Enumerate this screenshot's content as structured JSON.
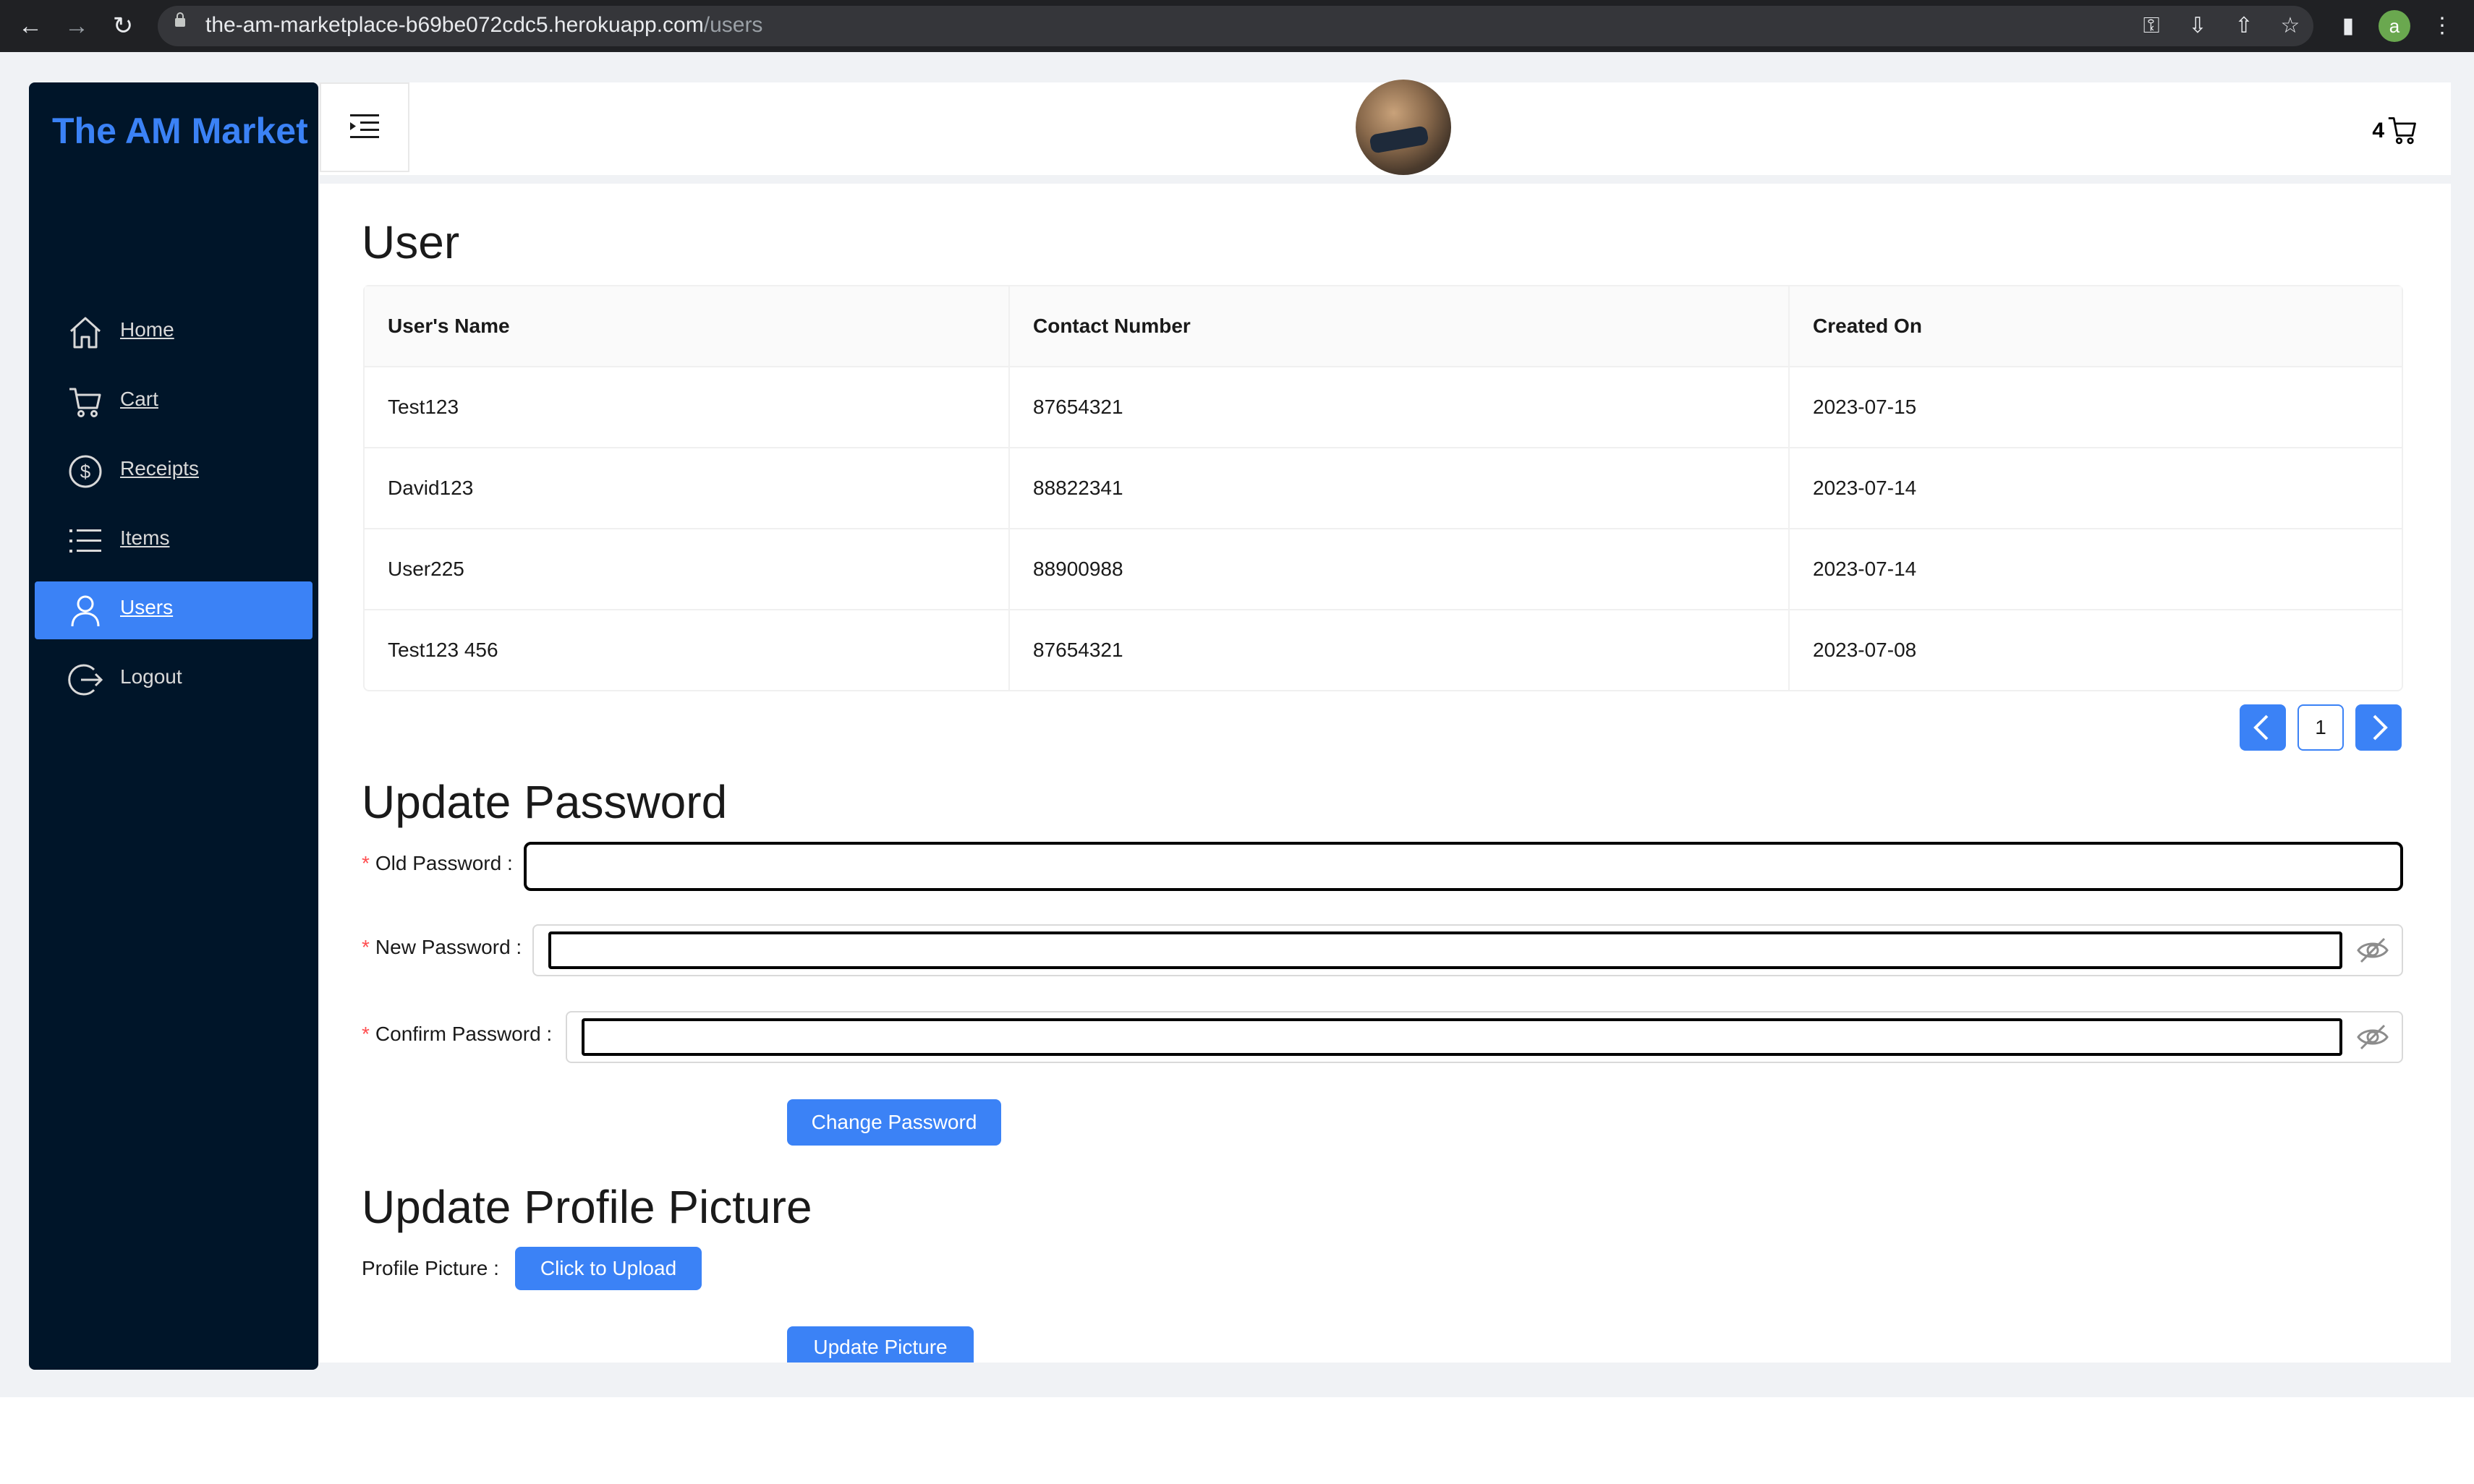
{
  "browser": {
    "url_host": "the-am-marketplace-b69be072cdc5.herokuapp.com",
    "url_path": "/users",
    "profile_initial": "a"
  },
  "sidebar": {
    "logo": "The AM Market",
    "items": [
      {
        "label": "Home",
        "icon": "home-icon"
      },
      {
        "label": "Cart",
        "icon": "cart-icon"
      },
      {
        "label": "Receipts",
        "icon": "dollar-icon"
      },
      {
        "label": "Items",
        "icon": "list-icon"
      },
      {
        "label": "Users",
        "icon": "user-icon",
        "active": true
      },
      {
        "label": "Logout",
        "icon": "logout-icon"
      }
    ]
  },
  "header": {
    "cart_count": "4"
  },
  "users": {
    "title": "User",
    "columns": [
      "User's Name",
      "Contact Number",
      "Created On"
    ],
    "rows": [
      [
        "Test123",
        "87654321",
        "2023-07-15"
      ],
      [
        "David123",
        "88822341",
        "2023-07-14"
      ],
      [
        "User225",
        "88900988",
        "2023-07-14"
      ],
      [
        "Test123 456",
        "87654321",
        "2023-07-08"
      ]
    ],
    "page": "1"
  },
  "password": {
    "title": "Update Password",
    "old_label": "Old Password",
    "new_label": "New Password",
    "confirm_label": "Confirm Password",
    "required_mark": "*",
    "submit": "Change Password"
  },
  "profile": {
    "title": "Update Profile Picture",
    "label": "Profile Picture",
    "upload": "Click to Upload",
    "submit": "Update Picture"
  },
  "colors": {
    "accent": "#3b82f6",
    "sider": "#001529",
    "required": "#ff4d4f"
  }
}
